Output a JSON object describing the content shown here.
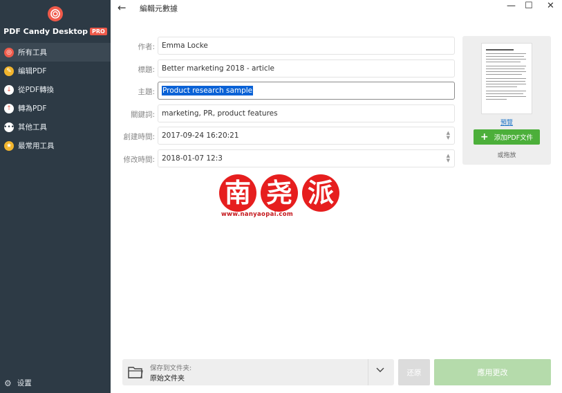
{
  "app": {
    "brand": "PDF Candy Desktop",
    "badge": "PRO",
    "brand_color": "#ef5a4a"
  },
  "sidebar": {
    "items": [
      {
        "label": "所有工具",
        "icon": "candy-icon",
        "color": "#ef5a4a",
        "active": true
      },
      {
        "label": "编辑PDF",
        "icon": "pencil-icon",
        "color": "#f2b52d",
        "active": false
      },
      {
        "label": "從PDF轉換",
        "icon": "arrow-down-icon",
        "color": "#ef5a4a",
        "active": false
      },
      {
        "label": "轉為PDF",
        "icon": "arrow-up-icon",
        "color": "#ef5a4a",
        "active": false
      },
      {
        "label": "其他工具",
        "icon": "more-icon",
        "color": "#4a5865",
        "active": false
      },
      {
        "label": "最常用工具",
        "icon": "star-icon",
        "color": "#f2b52d",
        "active": false
      }
    ],
    "settings_label": "设置"
  },
  "header": {
    "title": "編輯元數據"
  },
  "form": {
    "author": {
      "label": "作者:",
      "value": "Emma Locke"
    },
    "title": {
      "label": "標題:",
      "value": "Better marketing 2018 - article"
    },
    "subject": {
      "label": "主題:",
      "value": "Product research sample"
    },
    "keywords": {
      "label": "關鍵詞:",
      "value": "marketing, PR, product features"
    },
    "created": {
      "label": "創建時間:",
      "value": "2017-09-24 16:20:21"
    },
    "modified": {
      "label": "修改時間:",
      "value": "2018-01-07 12:3"
    }
  },
  "preview": {
    "link": "預覽",
    "add_button": "添加PDF文件",
    "or_drop": "或拖放"
  },
  "watermark": {
    "chars": [
      "南",
      "尧",
      "派"
    ],
    "url": "www.nanyaopai.com"
  },
  "footer": {
    "save_to_label": "保存到文件夹:",
    "save_to_value": "原始文件夹",
    "restore_label": "还原",
    "apply_label": "應用更改"
  }
}
